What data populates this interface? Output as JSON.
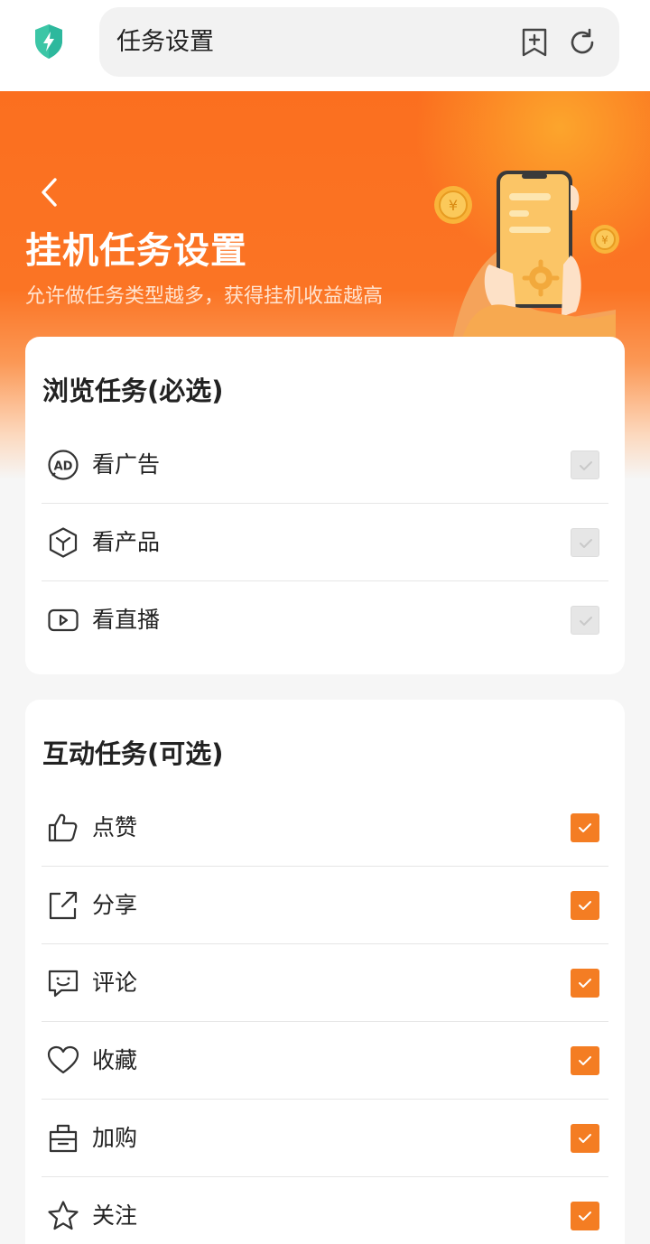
{
  "browser": {
    "url_title": "任务设置"
  },
  "header": {
    "title": "挂机任务设置",
    "subtitle": "允许做任务类型越多，获得挂机收益越高"
  },
  "sections": {
    "browse": {
      "title": "浏览任务(必选)",
      "items": [
        {
          "label": "看广告",
          "icon": "ad-icon",
          "checked": true,
          "disabled": true
        },
        {
          "label": "看产品",
          "icon": "product-cube-icon",
          "checked": true,
          "disabled": true
        },
        {
          "label": "看直播",
          "icon": "live-video-icon",
          "checked": true,
          "disabled": true
        }
      ]
    },
    "interact": {
      "title": "互动任务(可选)",
      "items": [
        {
          "label": "点赞",
          "icon": "thumbs-up-icon",
          "checked": true
        },
        {
          "label": "分享",
          "icon": "share-icon",
          "checked": true
        },
        {
          "label": "评论",
          "icon": "comment-icon",
          "checked": true
        },
        {
          "label": "收藏",
          "icon": "heart-icon",
          "checked": true
        },
        {
          "label": "加购",
          "icon": "shopping-bag-icon",
          "checked": true
        },
        {
          "label": "关注",
          "icon": "star-icon",
          "checked": true
        }
      ]
    }
  },
  "colors": {
    "accent": "#f47d23",
    "hero_orange": "#fb6f1f",
    "shield": "#2ec4b0"
  }
}
